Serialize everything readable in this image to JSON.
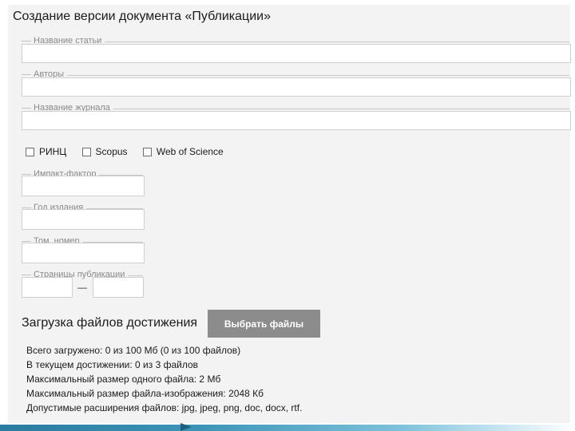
{
  "form": {
    "title": "Создание версии документа «Публикации»",
    "fields": {
      "article_title": {
        "label": "Название статьи",
        "value": ""
      },
      "authors": {
        "label": "Авторы",
        "value": ""
      },
      "journal": {
        "label": "Название журнала",
        "value": ""
      },
      "impact": {
        "label": "Импакт-фактор",
        "value": ""
      },
      "year": {
        "label": "Год издания",
        "value": ""
      },
      "volume": {
        "label": "Том, номер",
        "value": ""
      },
      "pages": {
        "label": "Страницы публикации",
        "from": "",
        "to": ""
      }
    },
    "pages_separator": "—",
    "checkboxes": [
      {
        "label": "РИНЦ",
        "checked": false
      },
      {
        "label": "Scopus",
        "checked": false
      },
      {
        "label": "Web of Science",
        "checked": false
      }
    ]
  },
  "upload": {
    "title": "Загрузка файлов достижения",
    "button_label": "Выбрать файлы",
    "info": [
      "Всего загружено: 0 из 100 Мб (0 из 100 файлов)",
      "В текущем достижении: 0 из 3 файлов",
      "Максимальный размер одного файла: 2 Мб",
      "Максимальный размер файла-изображения: 2048 Кб",
      "Допустимые расширения файлов: jpg, jpeg, png, doc, docx, rtf."
    ]
  },
  "colors": {
    "panel_bg": "#f3f3f3",
    "button_bg": "#8c8c8c",
    "footer_accent": "#2a7ba0"
  }
}
